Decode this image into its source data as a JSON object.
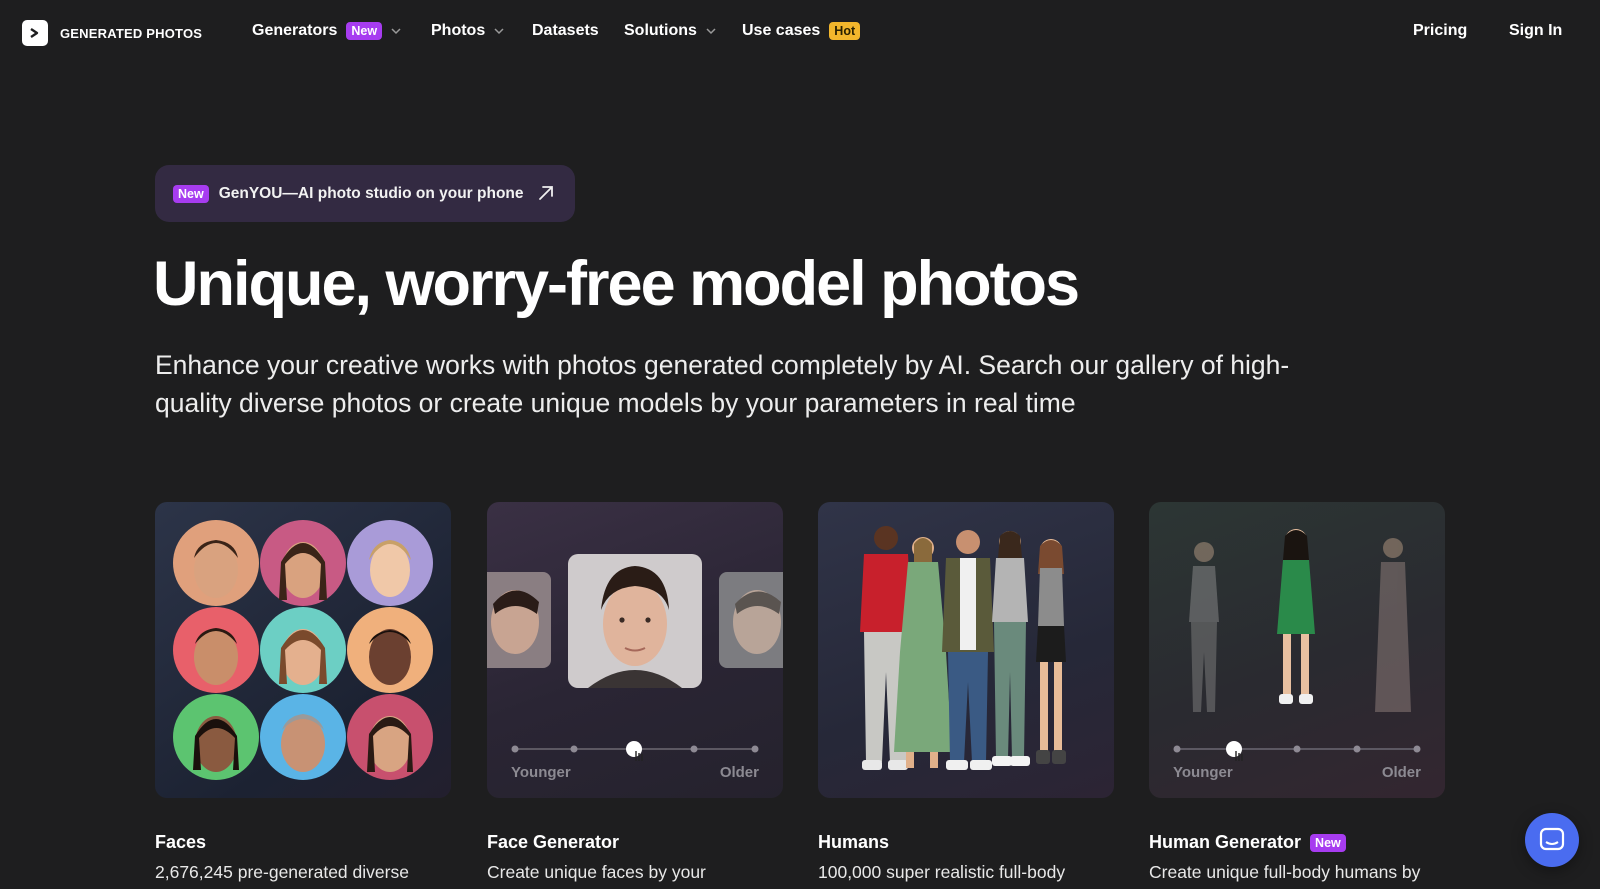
{
  "brand": {
    "name": "GENERATED PHOTOS",
    "logo_icon": "chevron-right-icon"
  },
  "nav": {
    "generators": {
      "label": "Generators",
      "badge": "New"
    },
    "photos": {
      "label": "Photos"
    },
    "datasets": {
      "label": "Datasets"
    },
    "solutions": {
      "label": "Solutions"
    },
    "use_cases": {
      "label": "Use cases",
      "badge": "Hot"
    },
    "pricing": "Pricing",
    "sign_in": "Sign In"
  },
  "promo": {
    "badge": "New",
    "text": "GenYOU—AI photo studio on your phone",
    "icon": "arrow-up-right-icon"
  },
  "hero": {
    "title": "Unique, worry-free model photos",
    "subtitle": "Enhance your creative works with photos generated completely by AI. Search our gallery of high-quality diverse photos or create unique models by your parameters in real time"
  },
  "cards": [
    {
      "title": "Faces",
      "description": "2,676,245 pre-generated diverse"
    },
    {
      "title": "Face Generator",
      "description": "Create unique faces by your",
      "slider": {
        "min_label": "Younger",
        "max_label": "Older"
      }
    },
    {
      "title": "Humans",
      "description": "100,000 super realistic full-body"
    },
    {
      "title": "Human Generator",
      "badge": "New",
      "description": "Create unique full-body humans by",
      "slider": {
        "min_label": "Younger",
        "max_label": "Older"
      }
    }
  ],
  "colors": {
    "background": "#1e1e1f",
    "badge_new": "#a73cf0",
    "badge_hot": "#f2b62c",
    "promo_bg": "#332a42",
    "chat_button": "#4a6cf0"
  },
  "chat": {
    "icon": "chat-bubble-icon"
  }
}
